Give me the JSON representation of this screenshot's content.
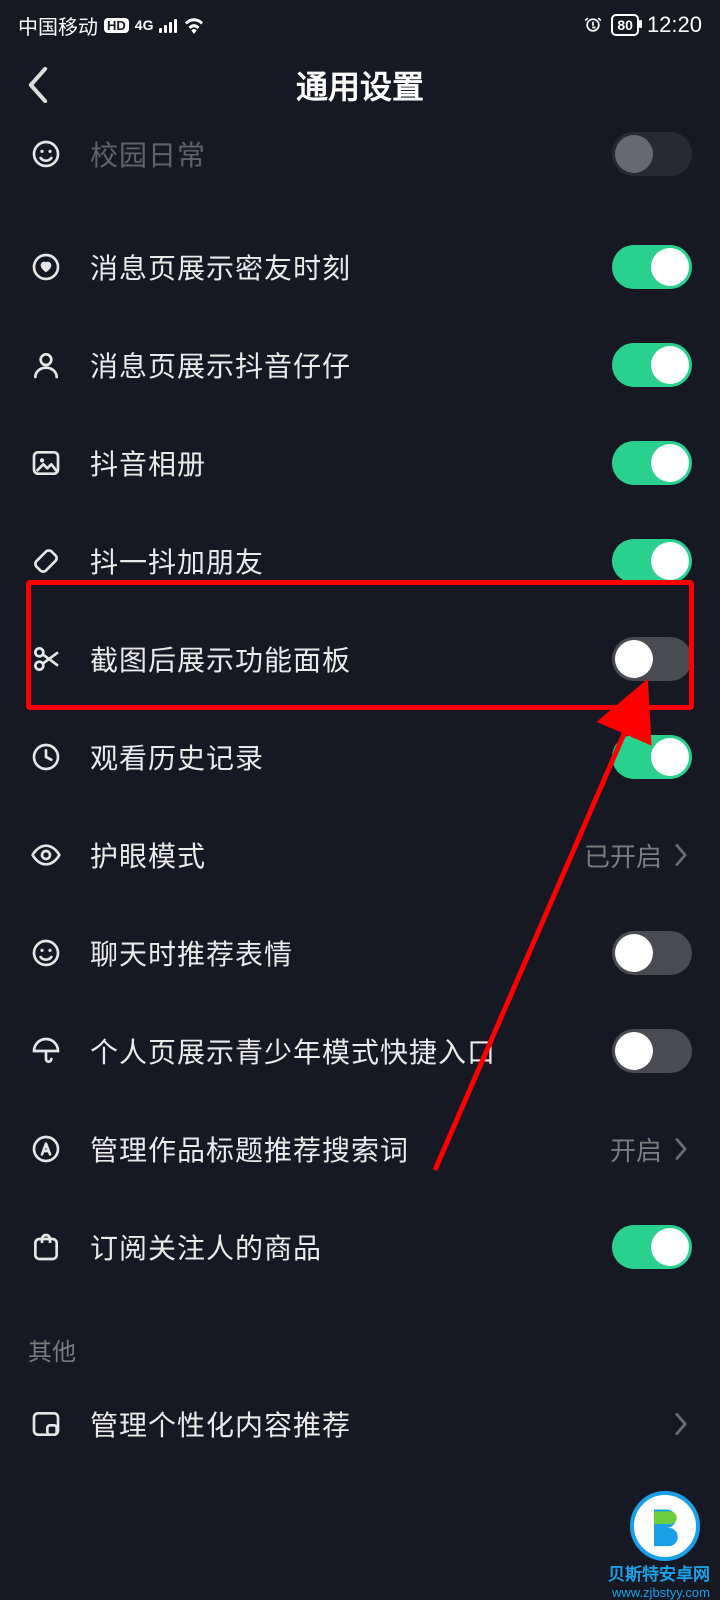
{
  "status": {
    "carrier": "中国移动",
    "battery": "80",
    "time": "12:20"
  },
  "header": {
    "title": "通用设置"
  },
  "rows": {
    "r0": {
      "label": "校园日常"
    },
    "r1": {
      "label": "消息页展示密友时刻"
    },
    "r2": {
      "label": "消息页展示抖音仔仔"
    },
    "r3": {
      "label": "抖音相册"
    },
    "r4": {
      "label": "抖一抖加朋友"
    },
    "r5": {
      "label": "截图后展示功能面板"
    },
    "r6": {
      "label": "观看历史记录"
    },
    "r7": {
      "label": "护眼模式",
      "value": "已开启"
    },
    "r8": {
      "label": "聊天时推荐表情"
    },
    "r9": {
      "label": "个人页展示青少年模式快捷入口"
    },
    "r10": {
      "label": "管理作品标题推荐搜索词",
      "value": "开启"
    },
    "r11": {
      "label": "订阅关注人的商品"
    }
  },
  "section": {
    "other": "其他"
  },
  "rows2": {
    "r12": {
      "label": "管理个性化内容推荐"
    }
  },
  "watermark": {
    "name": "贝斯特安卓网",
    "url": "www.zjbstyy.com"
  }
}
